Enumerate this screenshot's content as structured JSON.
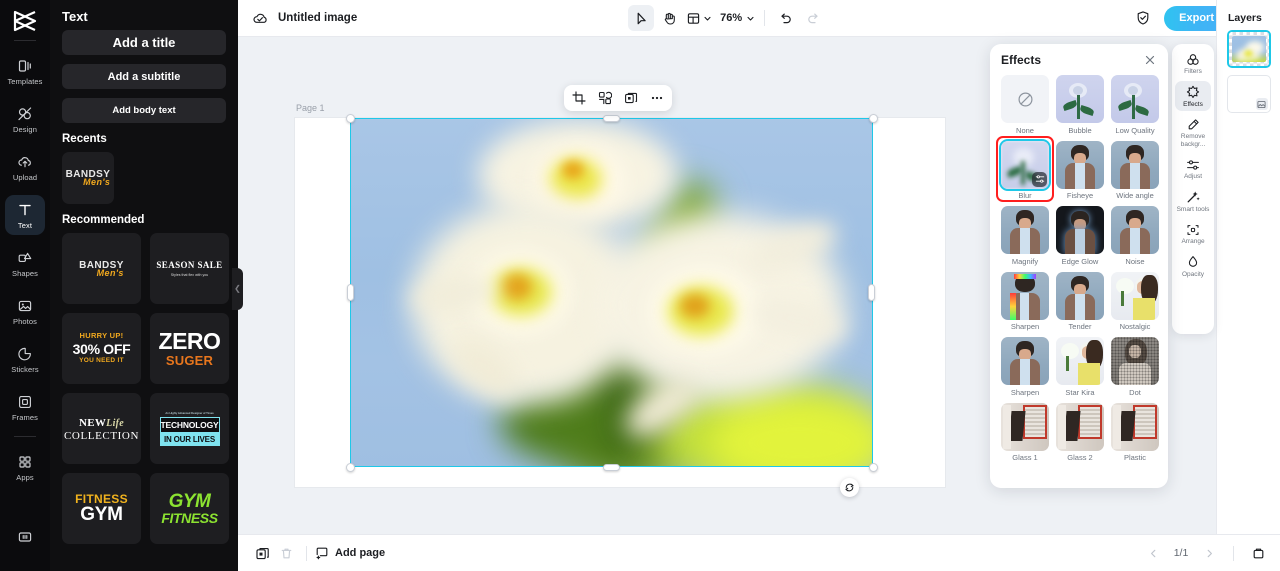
{
  "app": {
    "logo_icon": "capcut-logo-icon",
    "accent": "#1ec8e8",
    "export_gradient_start": "#2fc3f0",
    "selection_color": "#1ec8e8",
    "highlight_ring": "#ff1f1f"
  },
  "rail": {
    "items": [
      {
        "label": "Templates",
        "icon": "templates-icon",
        "active": false
      },
      {
        "label": "Design",
        "icon": "design-icon",
        "active": false
      },
      {
        "label": "Upload",
        "icon": "upload-cloud-icon",
        "active": false
      },
      {
        "label": "Text",
        "icon": "text-icon",
        "active": true
      },
      {
        "label": "Shapes",
        "icon": "shapes-icon",
        "active": false
      },
      {
        "label": "Photos",
        "icon": "photos-icon",
        "active": false
      },
      {
        "label": "Stickers",
        "icon": "stickers-icon",
        "active": false
      },
      {
        "label": "Frames",
        "icon": "frames-icon",
        "active": false
      },
      {
        "label": "Apps",
        "icon": "apps-grid-icon",
        "active": false
      }
    ],
    "bottom_icon": "panel-toggle-icon"
  },
  "panel": {
    "title": "Text",
    "buttons": [
      {
        "label": "Add a title"
      },
      {
        "label": "Add a subtitle"
      },
      {
        "label": "Add body text"
      }
    ],
    "recents_heading": "Recents",
    "recents": [
      {
        "name": "bandsy-mens",
        "line1": "BANDSY",
        "line2": "Men's"
      }
    ],
    "recommended_heading": "Recommended",
    "recommended": [
      {
        "name": "bandsy-mens",
        "line1": "BANDSY",
        "line2": "Men's"
      },
      {
        "name": "season-sale",
        "line1": "SEASON SALE",
        "line2": "Styles that flex with you"
      },
      {
        "name": "hurry-30-off",
        "line1": "HURRY UP!",
        "line2": "30% OFF",
        "line3": "YOU NEED IT"
      },
      {
        "name": "zero-suger",
        "line1": "ZERO",
        "line2": "SUGER"
      },
      {
        "name": "new-life-collection",
        "line1": "NEW",
        "line1b": "Life",
        "line2": "COLLECTION"
      },
      {
        "name": "technology-in-our-lives",
        "line0": "An Highly Advanced Designer of Times",
        "line1": "TECHNOLOGY",
        "line2": "IN OUR LIVES"
      },
      {
        "name": "fitness-gym",
        "line1": "FITNESS",
        "line2": "GYM"
      },
      {
        "name": "gym-fitness",
        "line1": "GYM",
        "line2": "FITNESS"
      }
    ],
    "collapse_handle_icon": "chevron-left-icon"
  },
  "topbar": {
    "cloud_icon": "cloud-sync-icon",
    "doc_title": "Untitled image",
    "tools": [
      {
        "name": "select-tool",
        "icon": "cursor-arrow-icon",
        "selected": true
      },
      {
        "name": "hand-tool",
        "icon": "hand-icon",
        "selected": false
      }
    ],
    "layout_icon": "layout-grid-icon",
    "layout_caret": "chevron-down-icon",
    "zoom_value": "76%",
    "zoom_caret": "chevron-down-icon",
    "undo_icon": "undo-icon",
    "redo_icon": "redo-icon",
    "shield_icon": "shield-check-icon",
    "export_label": "Export",
    "avatar": "user-avatar"
  },
  "canvas": {
    "page_label": "Page 1",
    "float_toolbar": [
      {
        "name": "crop-button",
        "icon": "crop-icon"
      },
      {
        "name": "cutout-button",
        "icon": "cutout-icon"
      },
      {
        "name": "duplicate-button",
        "icon": "duplicate-icon"
      },
      {
        "name": "more-button",
        "icon": "ellipsis-icon"
      }
    ],
    "rotate_icon": "rotate-icon",
    "image_alt": "blurred white daisy flowers against blue sky"
  },
  "effects": {
    "title": "Effects",
    "close_icon": "close-icon",
    "selected": "Blur",
    "items": [
      {
        "label": "None",
        "kind": "none",
        "icon": "no-effect-icon"
      },
      {
        "label": "Bubble",
        "kind": "rose"
      },
      {
        "label": "Low Quality",
        "kind": "rose"
      },
      {
        "label": "Blur",
        "kind": "rose-blur",
        "selected": true,
        "gear_icon": "sliders-icon"
      },
      {
        "label": "Fisheye",
        "kind": "man"
      },
      {
        "label": "Wide angle",
        "kind": "man"
      },
      {
        "label": "Magnify",
        "kind": "man"
      },
      {
        "label": "Edge Glow",
        "kind": "man-dark"
      },
      {
        "label": "Noise",
        "kind": "man"
      },
      {
        "label": "Sharpen",
        "kind": "man-rainbow"
      },
      {
        "label": "Tender",
        "kind": "man"
      },
      {
        "label": "Nostalgic",
        "kind": "woman"
      },
      {
        "label": "Sharpen",
        "kind": "man"
      },
      {
        "label": "Star Kira",
        "kind": "woman"
      },
      {
        "label": "Dot",
        "kind": "woman-gray"
      },
      {
        "label": "Glass 1",
        "kind": "glass"
      },
      {
        "label": "Glass 2",
        "kind": "glass"
      },
      {
        "label": "Plastic",
        "kind": "glass"
      }
    ]
  },
  "right_rail": {
    "items": [
      {
        "label": "Filters",
        "icon": "filters-icon",
        "active": false
      },
      {
        "label": "Effects",
        "icon": "effects-star-icon",
        "active": true
      },
      {
        "label": "Remove backgr...",
        "icon": "remove-background-icon",
        "active": false
      },
      {
        "label": "Adjust",
        "icon": "adjust-sliders-icon",
        "active": false
      },
      {
        "label": "Smart tools",
        "icon": "magic-wand-icon",
        "active": false
      },
      {
        "label": "Arrange",
        "icon": "arrange-icon",
        "active": false
      },
      {
        "label": "Opacity",
        "icon": "opacity-drop-icon",
        "active": false
      }
    ]
  },
  "layers": {
    "title": "Layers",
    "items": [
      {
        "name": "layer-image",
        "selected": true,
        "kind": "image"
      },
      {
        "name": "layer-blank",
        "selected": false,
        "kind": "blank",
        "badge_icon": "image-placeholder-icon"
      }
    ]
  },
  "bottombar": {
    "duplicate_icon": "duplicate-page-icon",
    "delete_icon": "trash-icon",
    "add_page_icon": "add-page-icon",
    "add_page_label": "Add page",
    "prev_icon": "chevron-left-icon",
    "page_indicator": "1/1",
    "next_icon": "chevron-right-icon",
    "grid_icon": "pages-grid-icon"
  }
}
